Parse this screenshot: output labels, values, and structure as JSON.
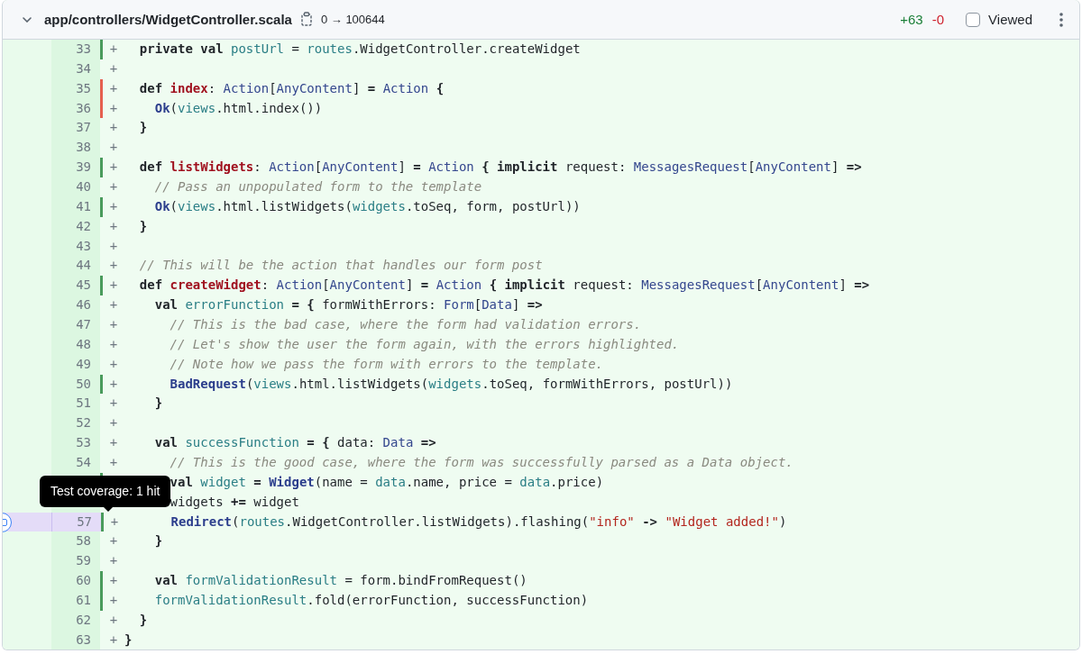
{
  "file": {
    "expanded": true,
    "path": "app/controllers/WidgetController.scala",
    "mode_change": "0 → 100644",
    "additions": "+63",
    "deletions": "-0",
    "viewed": false,
    "viewed_label": "Viewed"
  },
  "tooltip": {
    "text": "Test coverage: 1 hit"
  },
  "lines": [
    {
      "number": "33",
      "sign": "+",
      "color": "#4a9b5c",
      "selected": false,
      "tokens": [
        {
          "kind": "keyword",
          "text": "  private val "
        },
        {
          "kind": "variable",
          "text": "postUrl"
        },
        {
          "kind": "plain",
          "text": " = "
        },
        {
          "kind": "variable",
          "text": "routes"
        },
        {
          "kind": "plain",
          "text": ".WidgetController.createWidget"
        }
      ]
    },
    {
      "number": "34",
      "sign": "+",
      "selected": false
    },
    {
      "number": "35",
      "sign": "+",
      "color": "#e5604f",
      "selected": false,
      "tokens": [
        {
          "kind": "keyword",
          "text": "  def "
        },
        {
          "kind": "definition",
          "text": "index"
        },
        {
          "kind": "plain",
          "text": ": "
        },
        {
          "kind": "type",
          "text": "Action"
        },
        {
          "kind": "plain",
          "text": "["
        },
        {
          "kind": "type",
          "text": "AnyContent"
        },
        {
          "kind": "plain",
          "text": "] "
        },
        {
          "kind": "keyword",
          "text": "= "
        },
        {
          "kind": "type",
          "text": "Action"
        },
        {
          "kind": "keyword",
          "text": " {"
        }
      ]
    },
    {
      "number": "36",
      "sign": "+",
      "color": "#e5604f",
      "selected": false,
      "tokens": [
        {
          "kind": "call",
          "text": "    Ok"
        },
        {
          "kind": "plain",
          "text": "("
        },
        {
          "kind": "variable",
          "text": "views"
        },
        {
          "kind": "plain",
          "text": ".html.index())"
        }
      ]
    },
    {
      "number": "37",
      "sign": "+",
      "selected": false,
      "tokens": [
        {
          "kind": "keyword",
          "text": "  }"
        }
      ]
    },
    {
      "number": "38",
      "sign": "+",
      "selected": false
    },
    {
      "number": "39",
      "sign": "+",
      "color": "#4a9b5c",
      "selected": false,
      "tokens": [
        {
          "kind": "keyword",
          "text": "  def "
        },
        {
          "kind": "definition",
          "text": "listWidgets"
        },
        {
          "kind": "plain",
          "text": ": "
        },
        {
          "kind": "type",
          "text": "Action"
        },
        {
          "kind": "plain",
          "text": "["
        },
        {
          "kind": "type",
          "text": "AnyContent"
        },
        {
          "kind": "plain",
          "text": "] "
        },
        {
          "kind": "keyword",
          "text": "= "
        },
        {
          "kind": "type",
          "text": "Action"
        },
        {
          "kind": "keyword",
          "text": " { implicit "
        },
        {
          "kind": "plain",
          "text": "request: "
        },
        {
          "kind": "type",
          "text": "MessagesRequest"
        },
        {
          "kind": "plain",
          "text": "["
        },
        {
          "kind": "type",
          "text": "AnyContent"
        },
        {
          "kind": "plain",
          "text": "] "
        },
        {
          "kind": "keyword",
          "text": "=>"
        }
      ]
    },
    {
      "number": "40",
      "sign": "+",
      "selected": false,
      "tokens": [
        {
          "kind": "comment",
          "text": "    // Pass an unpopulated form to the template"
        }
      ]
    },
    {
      "number": "41",
      "sign": "+",
      "color": "#4a9b5c",
      "selected": false,
      "tokens": [
        {
          "kind": "call",
          "text": "    Ok"
        },
        {
          "kind": "plain",
          "text": "("
        },
        {
          "kind": "variable",
          "text": "views"
        },
        {
          "kind": "plain",
          "text": ".html.listWidgets("
        },
        {
          "kind": "variable",
          "text": "widgets"
        },
        {
          "kind": "plain",
          "text": ".toSeq, form, postUrl))"
        }
      ]
    },
    {
      "number": "42",
      "sign": "+",
      "selected": false,
      "tokens": [
        {
          "kind": "keyword",
          "text": "  }"
        }
      ]
    },
    {
      "number": "43",
      "sign": "+",
      "selected": false
    },
    {
      "number": "44",
      "sign": "+",
      "selected": false,
      "tokens": [
        {
          "kind": "comment",
          "text": "  // This will be the action that handles our form post"
        }
      ]
    },
    {
      "number": "45",
      "sign": "+",
      "color": "#4a9b5c",
      "selected": false,
      "tokens": [
        {
          "kind": "keyword",
          "text": "  def "
        },
        {
          "kind": "definition",
          "text": "createWidget"
        },
        {
          "kind": "plain",
          "text": ": "
        },
        {
          "kind": "type",
          "text": "Action"
        },
        {
          "kind": "plain",
          "text": "["
        },
        {
          "kind": "type",
          "text": "AnyContent"
        },
        {
          "kind": "plain",
          "text": "] "
        },
        {
          "kind": "keyword",
          "text": "= "
        },
        {
          "kind": "type",
          "text": "Action"
        },
        {
          "kind": "keyword",
          "text": " { implicit "
        },
        {
          "kind": "plain",
          "text": "request: "
        },
        {
          "kind": "type",
          "text": "MessagesRequest"
        },
        {
          "kind": "plain",
          "text": "["
        },
        {
          "kind": "type",
          "text": "AnyContent"
        },
        {
          "kind": "plain",
          "text": "] "
        },
        {
          "kind": "keyword",
          "text": "=>"
        }
      ]
    },
    {
      "number": "46",
      "sign": "+",
      "selected": false,
      "tokens": [
        {
          "kind": "keyword",
          "text": "    val "
        },
        {
          "kind": "variable",
          "text": "errorFunction"
        },
        {
          "kind": "keyword",
          "text": " = { "
        },
        {
          "kind": "plain",
          "text": "formWithErrors: "
        },
        {
          "kind": "type",
          "text": "Form"
        },
        {
          "kind": "plain",
          "text": "["
        },
        {
          "kind": "type",
          "text": "Data"
        },
        {
          "kind": "plain",
          "text": "] "
        },
        {
          "kind": "keyword",
          "text": "=>"
        }
      ]
    },
    {
      "number": "47",
      "sign": "+",
      "selected": false,
      "tokens": [
        {
          "kind": "comment",
          "text": "      // This is the bad case, where the form had validation errors."
        }
      ]
    },
    {
      "number": "48",
      "sign": "+",
      "selected": false,
      "tokens": [
        {
          "kind": "comment",
          "text": "      // Let's show the user the form again, with the errors highlighted."
        }
      ]
    },
    {
      "number": "49",
      "sign": "+",
      "selected": false,
      "tokens": [
        {
          "kind": "comment",
          "text": "      // Note how we pass the form with errors to the template."
        }
      ]
    },
    {
      "number": "50",
      "sign": "+",
      "color": "#4a9b5c",
      "selected": false,
      "tokens": [
        {
          "kind": "call",
          "text": "      BadRequest"
        },
        {
          "kind": "plain",
          "text": "("
        },
        {
          "kind": "variable",
          "text": "views"
        },
        {
          "kind": "plain",
          "text": ".html.listWidgets("
        },
        {
          "kind": "variable",
          "text": "widgets"
        },
        {
          "kind": "plain",
          "text": ".toSeq, formWithErrors, postUrl))"
        }
      ]
    },
    {
      "number": "51",
      "sign": "+",
      "selected": false,
      "tokens": [
        {
          "kind": "keyword",
          "text": "    }"
        }
      ]
    },
    {
      "number": "52",
      "sign": "+",
      "selected": false
    },
    {
      "number": "53",
      "sign": "+",
      "selected": false,
      "tokens": [
        {
          "kind": "keyword",
          "text": "    val "
        },
        {
          "kind": "variable",
          "text": "successFunction"
        },
        {
          "kind": "keyword",
          "text": " = { "
        },
        {
          "kind": "plain",
          "text": "data: "
        },
        {
          "kind": "type",
          "text": "Data"
        },
        {
          "kind": "keyword",
          "text": " =>"
        }
      ]
    },
    {
      "number": "54",
      "sign": "+",
      "selected": false,
      "tokens": [
        {
          "kind": "comment",
          "text": "      // This is the good case, where the form was successfully parsed as a Data object."
        }
      ]
    },
    {
      "color": "#4a9b5c",
      "selected": false,
      "tokens": [
        {
          "kind": "keyword",
          "text": "      val "
        },
        {
          "kind": "variable",
          "text": "widget"
        },
        {
          "kind": "keyword",
          "text": " = "
        },
        {
          "kind": "call",
          "text": "Widget"
        },
        {
          "kind": "plain",
          "text": "(name = "
        },
        {
          "kind": "variable",
          "text": "data"
        },
        {
          "kind": "plain",
          "text": ".name, price = "
        },
        {
          "kind": "variable",
          "text": "data"
        },
        {
          "kind": "plain",
          "text": ".price)"
        }
      ]
    },
    {
      "selected": false,
      "tokens": [
        {
          "kind": "plain",
          "text": "      widgets "
        },
        {
          "kind": "keyword",
          "text": "+="
        },
        {
          "kind": "plain",
          "text": " widget"
        }
      ]
    },
    {
      "number": "57",
      "sign": "+",
      "color": "#4a9b5c",
      "selected": true,
      "tokens": [
        {
          "kind": "call",
          "text": "      Redirect"
        },
        {
          "kind": "plain",
          "text": "("
        },
        {
          "kind": "variable",
          "text": "routes"
        },
        {
          "kind": "plain",
          "text": ".WidgetController.listWidgets).flashing("
        },
        {
          "kind": "string",
          "text": "\"info\""
        },
        {
          "kind": "keyword",
          "text": " -> "
        },
        {
          "kind": "string",
          "text": "\"Widget added!\""
        },
        {
          "kind": "plain",
          "text": ")"
        }
      ]
    },
    {
      "number": "58",
      "sign": "+",
      "selected": false,
      "tokens": [
        {
          "kind": "keyword",
          "text": "    }"
        }
      ]
    },
    {
      "number": "59",
      "sign": "+",
      "selected": false
    },
    {
      "number": "60",
      "sign": "+",
      "color": "#4a9b5c",
      "selected": false,
      "tokens": [
        {
          "kind": "keyword",
          "text": "    val "
        },
        {
          "kind": "variable",
          "text": "formValidationResult"
        },
        {
          "kind": "plain",
          "text": " = form.bindFromRequest()"
        }
      ]
    },
    {
      "number": "61",
      "sign": "+",
      "color": "#4a9b5c",
      "selected": false,
      "tokens": [
        {
          "kind": "variable",
          "text": "    formValidationResult"
        },
        {
          "kind": "plain",
          "text": ".fold(errorFunction, successFunction)"
        }
      ]
    },
    {
      "number": "62",
      "sign": "+",
      "selected": false,
      "tokens": [
        {
          "kind": "keyword",
          "text": "  }"
        }
      ]
    },
    {
      "number": "63",
      "sign": "+",
      "selected": false,
      "tokens": [
        {
          "kind": "keyword",
          "text": "}"
        }
      ]
    }
  ]
}
